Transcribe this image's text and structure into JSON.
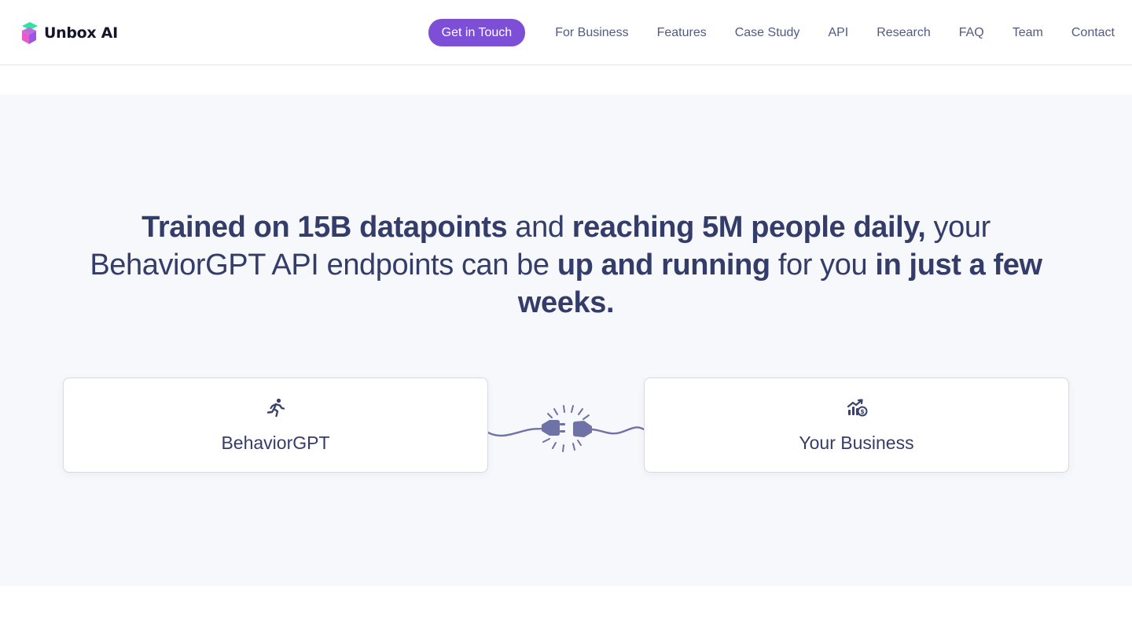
{
  "brand": {
    "name": "Unbox AI"
  },
  "nav": {
    "cta_label": "Get in Touch",
    "links": [
      "For Business",
      "Features",
      "Case Study",
      "API",
      "Research",
      "FAQ",
      "Team",
      "Contact"
    ]
  },
  "hero": {
    "headline": [
      {
        "text": "Trained on 15B datapoints",
        "bold": true
      },
      {
        "text": " and ",
        "bold": false
      },
      {
        "text": "reaching 5M people daily,",
        "bold": true
      },
      {
        "text": " your BehaviorGPT API endpoints can be ",
        "bold": false
      },
      {
        "text": "up and running",
        "bold": true
      },
      {
        "text": " for you ",
        "bold": false
      },
      {
        "text": "in just a few weeks.",
        "bold": true
      }
    ],
    "left_card": {
      "label": "BehaviorGPT",
      "icon": "running-person-icon"
    },
    "right_card": {
      "label": "Your Business",
      "icon": "growth-chart-dollar-icon"
    },
    "connector_icon": "plug-socket-icon"
  },
  "colors": {
    "accent": "#7c4fd6",
    "text": "#343c6a",
    "hero_bg": "#f7f8fc",
    "icon": "#6e72a6"
  }
}
